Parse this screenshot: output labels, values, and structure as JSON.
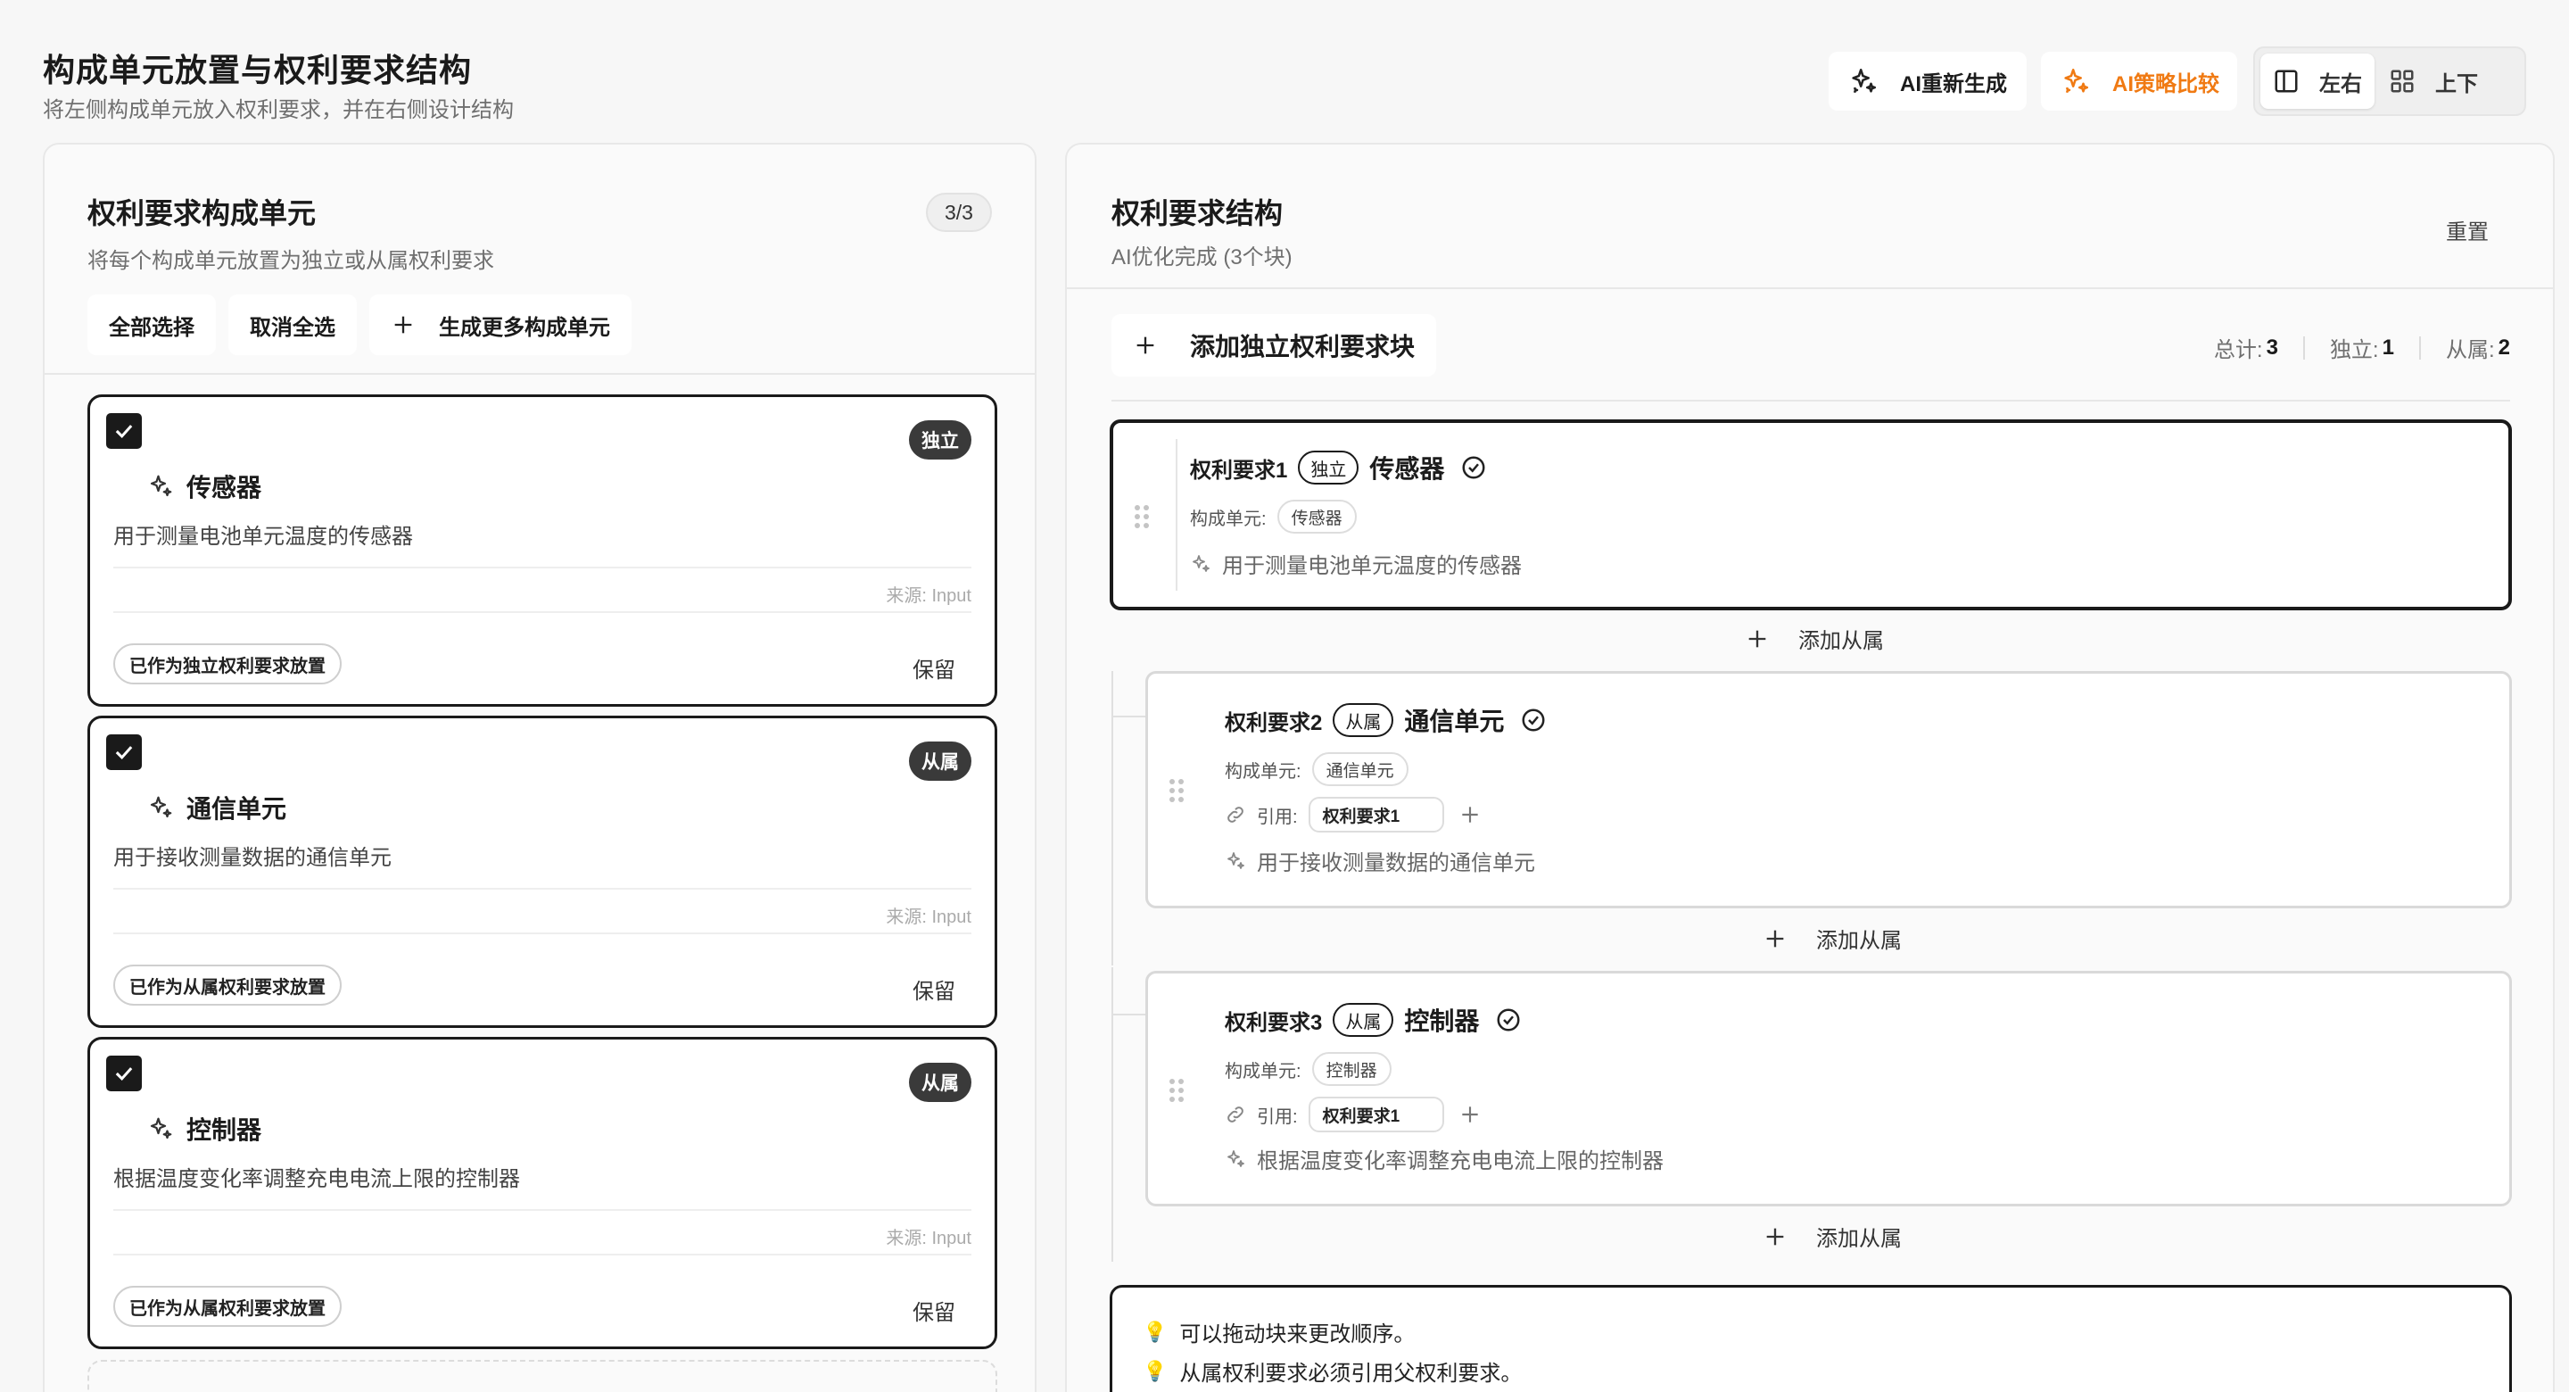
{
  "header": {
    "title": "构成单元放置与权利要求结构",
    "subtitle": "将左侧构成单元放入权利要求，并在右侧设计结构",
    "regen_label": "AI重新生成",
    "compare_label": "AI策略比较",
    "view_lr_label": "左右",
    "view_tb_label": "上下",
    "accent_color": "#f07a13"
  },
  "left": {
    "title": "权利要求构成单元",
    "subtitle": "将每个构成单元放置为独立或从属权利要求",
    "count": "3/3",
    "select_all": "全部选择",
    "deselect_all": "取消全选",
    "generate_more": "生成更多构成单元",
    "cards": [
      {
        "tag": "独立",
        "title": "传感器",
        "desc": "用于测量电池单元温度的传感器",
        "source": "来源: Input",
        "placement": "已作为独立权利要求放置",
        "keep": "保留",
        "checked": true
      },
      {
        "tag": "从属",
        "title": "通信单元",
        "desc": "用于接收测量数据的通信单元",
        "source": "来源: Input",
        "placement": "已作为从属权利要求放置",
        "keep": "保留",
        "checked": true
      },
      {
        "tag": "从属",
        "title": "控制器",
        "desc": "根据温度变化率调整充电电流上限的控制器",
        "source": "来源: Input",
        "placement": "已作为从属权利要求放置",
        "keep": "保留",
        "checked": true
      }
    ]
  },
  "right": {
    "title": "权利要求结构",
    "subtitle": "AI优化完成 (3个块)",
    "reset": "重置",
    "add_independent": "添加独立权利要求块",
    "stats": {
      "total_label": "总计:",
      "total": "3",
      "ind_label": "独立:",
      "ind": "1",
      "dep_label": "从属:",
      "dep": "2"
    },
    "element_label": "构成单元:",
    "ref_label": "引用:",
    "add_dependent": "添加从属",
    "claims": [
      {
        "num": "权利要求1",
        "tag": "独立",
        "name": "传感器",
        "element": "传感器",
        "desc": "用于测量电池单元温度的传感器"
      },
      {
        "num": "权利要求2",
        "tag": "从属",
        "name": "通信单元",
        "element": "通信单元",
        "ref": "权利要求1",
        "desc": "用于接收测量数据的通信单元"
      },
      {
        "num": "权利要求3",
        "tag": "从属",
        "name": "控制器",
        "element": "控制器",
        "ref": "权利要求1",
        "desc": "根据温度变化率调整充电电流上限的控制器"
      }
    ],
    "tips": [
      "可以拖动块来更改顺序。",
      "从属权利要求必须引用父权利要求。"
    ]
  }
}
